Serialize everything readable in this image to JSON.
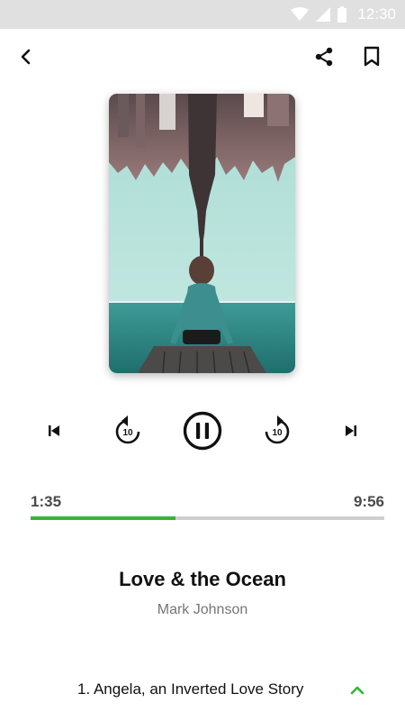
{
  "status_bar": {
    "time": "12:30"
  },
  "player": {
    "elapsed": "1:35",
    "total": "9:56",
    "progress": 0.41,
    "skip_back_seconds": "10",
    "skip_forward_seconds": "10",
    "state": "playing"
  },
  "book": {
    "title": "Love & the Ocean",
    "author": "Mark Johnson"
  },
  "chapter": {
    "label": "1. Angela, an Inverted Love Story"
  },
  "colors": {
    "accent": "#34b53a",
    "track": "#cfcfcf",
    "status_bar": "#e0e0e0"
  },
  "icons": {
    "back": "chevron-left-icon",
    "share": "share-icon",
    "bookmark": "bookmark-icon",
    "previous": "skip-previous-icon",
    "rewind": "replay-10-icon",
    "pause": "pause-circle-icon",
    "forward": "forward-10-icon",
    "next": "skip-next-icon",
    "expand": "chevron-up-icon"
  }
}
